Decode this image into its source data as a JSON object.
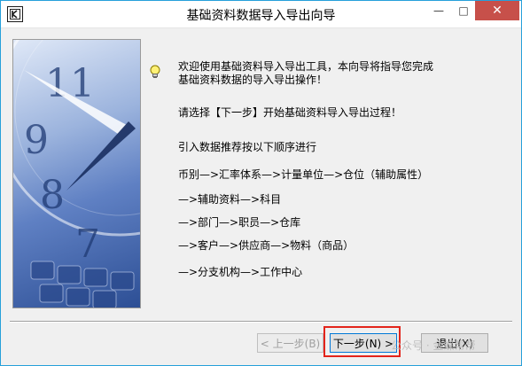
{
  "window": {
    "title": "基础资料数据导入导出向导"
  },
  "controls": {
    "minimize": "—",
    "maximize": "□",
    "close": "✕"
  },
  "messages": {
    "welcome_line1": "欢迎使用基础资料导入导出工具，本向导将指导您完成",
    "welcome_line2": "基础资料数据的导入导出操作！",
    "instruction": "请选择【下一步】开始基础资料导入导出过程！",
    "order_intro": "引入数据推荐按以下顺序进行",
    "step1": "币别—>汇率体系—>计量单位—>仓位（辅助属性）",
    "step2": "—>辅助资料—>科目",
    "step3": "—>部门—>职员—>仓库",
    "step4": "—>客户—>供应商—>物料（商品）",
    "step5": "—>分支机构—>工作中心"
  },
  "buttons": {
    "prev_label": "< 上一步(B)",
    "next_label": "下一步(N) >",
    "exit_label": "退出(X)"
  },
  "watermark": "公众号 · 金蝶帮帮",
  "icons": {
    "app": "app-icon",
    "hint": "lightbulb-icon"
  },
  "colors": {
    "highlight": "#e3241b",
    "close_button": "#c7504a",
    "window_border": "#26a0da"
  }
}
